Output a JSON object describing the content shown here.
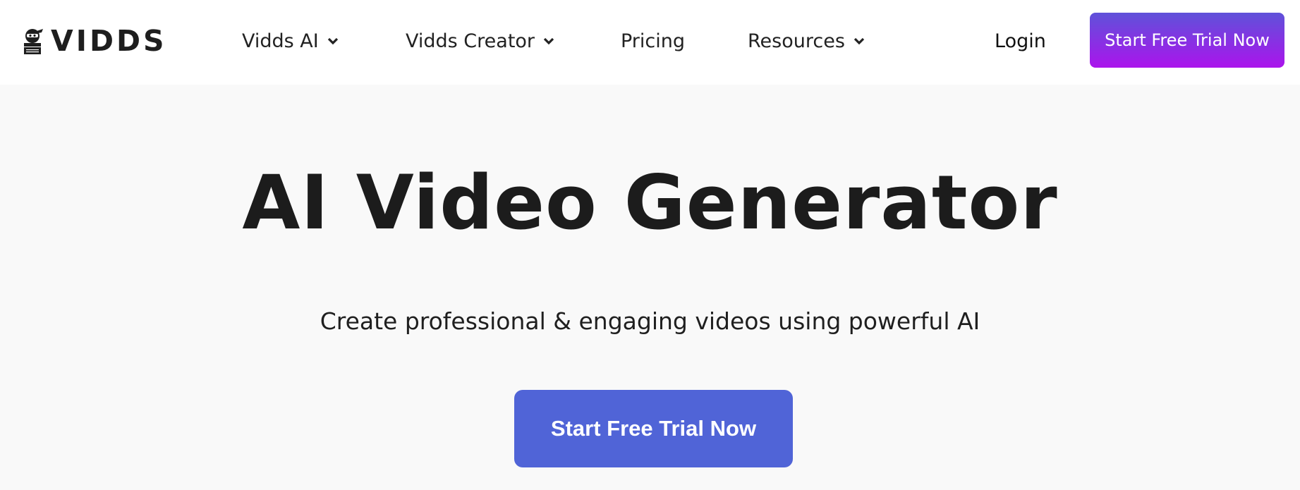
{
  "header": {
    "logo_text": "VIDDS",
    "logo_icon": "ninja-clapperboard-icon",
    "nav": [
      {
        "label": "Vidds AI",
        "has_dropdown": true,
        "icon": "chevron-down-icon"
      },
      {
        "label": "Vidds Creator",
        "has_dropdown": true,
        "icon": "chevron-down-icon"
      },
      {
        "label": "Pricing",
        "has_dropdown": false
      },
      {
        "label": "Resources",
        "has_dropdown": true,
        "icon": "chevron-down-icon"
      }
    ],
    "login_label": "Login",
    "cta_label": "Start Free Trial Now",
    "cta_gradient": [
      "#5f52d9",
      "#ab14ec"
    ]
  },
  "hero": {
    "title": "AI Video Generator",
    "subtitle": "Create professional & engaging videos using powerful AI",
    "cta_label": "Start Free Trial Now",
    "cta_color": "#5064d7"
  },
  "colors": {
    "header_bg": "#ffffff",
    "page_bg": "#f9f9f9",
    "text": "#1c1c1c"
  }
}
